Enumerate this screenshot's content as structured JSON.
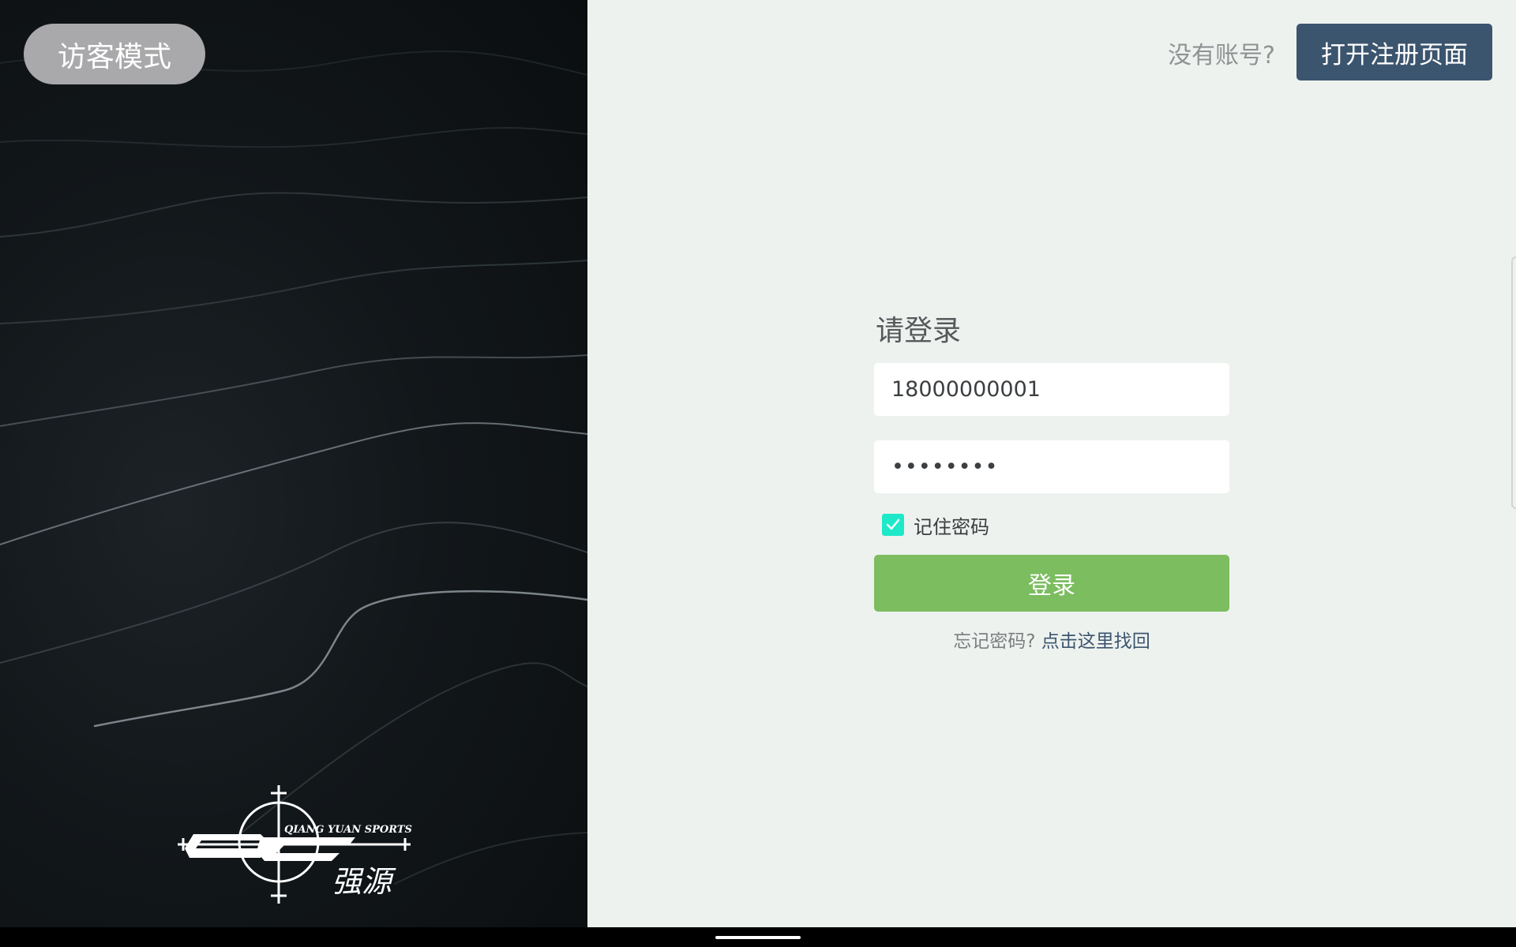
{
  "left": {
    "guest_button": "访客模式",
    "logo": {
      "brand_text": "QIANG YUAN SPORTS",
      "chinese_text": "强源"
    }
  },
  "header": {
    "no_account_text": "没有账号?",
    "register_button": "打开注册页面"
  },
  "login": {
    "title": "请登录",
    "username_value": "18000000001",
    "password_value": "12345678",
    "remember_label": "记住密码",
    "remember_checked": true,
    "login_button": "登录",
    "forgot_text": "忘记密码?",
    "forgot_link": "点击这里找回"
  },
  "colors": {
    "accent": "#3c556f",
    "login_button": "#7bbd5f",
    "checkbox": "#1de9c9",
    "background": "#eef2ef",
    "guest_button": "#a9a8aa"
  },
  "icons": [
    "check-icon",
    "qiang-yuan-logo"
  ]
}
